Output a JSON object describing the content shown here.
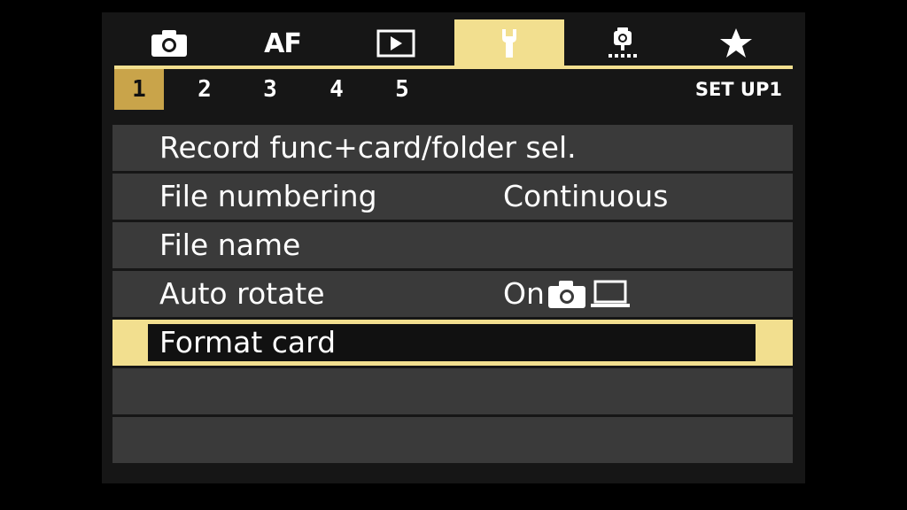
{
  "tabs": [
    {
      "name": "tab-shooting",
      "icon": "camera-icon",
      "text": ""
    },
    {
      "name": "tab-af",
      "icon": "",
      "text": "AF"
    },
    {
      "name": "tab-playback",
      "icon": "play-icon",
      "text": ""
    },
    {
      "name": "tab-setup",
      "icon": "wrench-icon",
      "text": "",
      "active": true
    },
    {
      "name": "tab-custom-functions",
      "icon": "custom-functions-icon",
      "text": ""
    },
    {
      "name": "tab-my-menu",
      "icon": "star-icon",
      "text": ""
    }
  ],
  "pages": [
    "1",
    "2",
    "3",
    "4",
    "5"
  ],
  "active_page": "1",
  "menu_name": "SET UP1",
  "rows": [
    {
      "label": "Record func+card/folder sel.",
      "value": ""
    },
    {
      "label": "File numbering",
      "value": "Continuous"
    },
    {
      "label": "File name",
      "value": ""
    },
    {
      "label": "Auto rotate",
      "value": "On"
    },
    {
      "label": "Format card",
      "value": "",
      "selected": true
    }
  ],
  "colors": {
    "accent": "#f2df8f",
    "active_page": "#c9a44a",
    "row_bg": "#3a3a3a",
    "screen_bg": "#161616"
  }
}
